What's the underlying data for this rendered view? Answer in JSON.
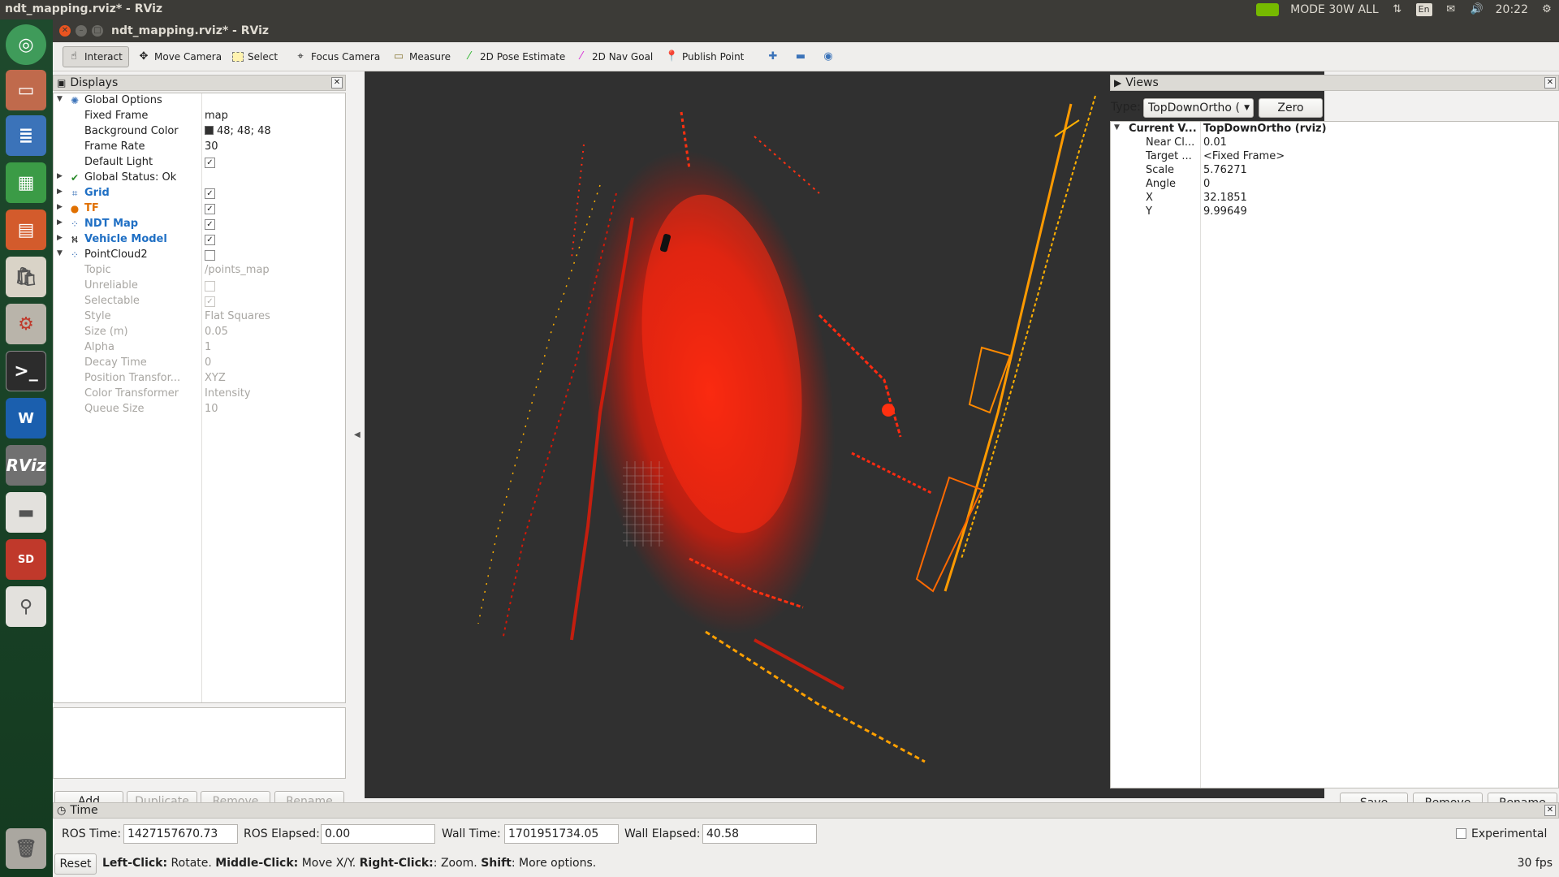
{
  "topbar": {
    "title": "ndt_mapping.rviz* - RViz",
    "mode": "MODE 30W ALL",
    "lang": "En",
    "clock": "20:22"
  },
  "launcher": {
    "items": [
      "ubuntu-icon",
      "files-icon",
      "writer-icon",
      "calc-icon",
      "impress-icon",
      "software-center-icon",
      "settings-icon",
      "terminal-icon",
      "autoware-icon",
      "rviz-icon",
      "drive-icon",
      "sd-card-icon",
      "usb-drive-icon",
      "trash-icon"
    ]
  },
  "window": {
    "title": "ndt_mapping.rviz* - RViz"
  },
  "toolbar": {
    "interact": "Interact",
    "move_camera": "Move Camera",
    "select": "Select",
    "focus_camera": "Focus Camera",
    "measure": "Measure",
    "pose_estimate": "2D Pose Estimate",
    "nav_goal": "2D Nav Goal",
    "publish_point": "Publish Point"
  },
  "displays": {
    "title": "Displays",
    "rows": [
      {
        "name": "Global Options",
        "value": ""
      },
      {
        "name": "Fixed Frame",
        "value": "map"
      },
      {
        "name": "Background Color",
        "value": "48; 48; 48"
      },
      {
        "name": "Frame Rate",
        "value": "30"
      },
      {
        "name": "Default Light",
        "value": "✓"
      },
      {
        "name": "Global Status: Ok",
        "value": ""
      },
      {
        "name": "Grid",
        "value": "✓"
      },
      {
        "name": "TF",
        "value": "✓"
      },
      {
        "name": "NDT Map",
        "value": "✓"
      },
      {
        "name": "Vehicle Model",
        "value": "✓"
      },
      {
        "name": "PointCloud2",
        "value": ""
      },
      {
        "name": "Topic",
        "value": "/points_map"
      },
      {
        "name": "Unreliable",
        "value": ""
      },
      {
        "name": "Selectable",
        "value": "✓"
      },
      {
        "name": "Style",
        "value": "Flat Squares"
      },
      {
        "name": "Size (m)",
        "value": "0.05"
      },
      {
        "name": "Alpha",
        "value": "1"
      },
      {
        "name": "Decay Time",
        "value": "0"
      },
      {
        "name": "Position Transfor...",
        "value": "XYZ"
      },
      {
        "name": "Color Transformer",
        "value": "Intensity"
      },
      {
        "name": "Queue Size",
        "value": "10"
      }
    ],
    "buttons": {
      "add": "Add",
      "duplicate": "Duplicate",
      "remove": "Remove",
      "rename": "Rename"
    }
  },
  "views": {
    "title": "Views",
    "type_label": "Type:",
    "type_value": "TopDownOrtho (",
    "zero": "Zero",
    "rows": [
      {
        "name": "Current V...",
        "value": "TopDownOrtho (rviz)"
      },
      {
        "name": "Near Cl...",
        "value": "0.01"
      },
      {
        "name": "Target ...",
        "value": "<Fixed Frame>"
      },
      {
        "name": "Scale",
        "value": "5.76271"
      },
      {
        "name": "Angle",
        "value": "0"
      },
      {
        "name": "X",
        "value": "32.1851"
      },
      {
        "name": "Y",
        "value": "9.99649"
      }
    ],
    "buttons": {
      "save": "Save",
      "remove": "Remove",
      "rename": "Rename"
    }
  },
  "time": {
    "title": "Time",
    "ros_time_label": "ROS Time:",
    "ros_time": "1427157670.73",
    "ros_elapsed_label": "ROS Elapsed:",
    "ros_elapsed": "0.00",
    "wall_time_label": "Wall Time:",
    "wall_time": "1701951734.05",
    "wall_elapsed_label": "Wall Elapsed:",
    "wall_elapsed": "40.58",
    "experimental": "Experimental",
    "reset": "Reset",
    "hint_left_bold": "Left-Click:",
    "hint_left": " Rotate. ",
    "hint_middle_bold": "Middle-Click:",
    "hint_middle": " Move X/Y. ",
    "hint_right_bold": "Right-Click:",
    "hint_right": ": Zoom. ",
    "hint_shift_bold": "Shift",
    "hint_shift": ": More options.",
    "fps": "30 fps"
  }
}
